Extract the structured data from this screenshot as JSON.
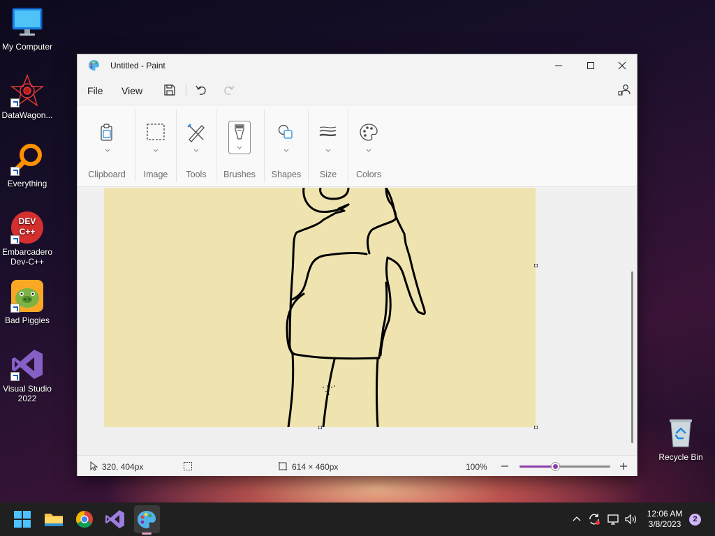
{
  "desktop": {
    "icons": [
      {
        "name": "my-computer",
        "label": "My Computer"
      },
      {
        "name": "datawagon",
        "label": "DataWagon..."
      },
      {
        "name": "everything",
        "label": "Everything"
      },
      {
        "name": "devcpp",
        "label": "Embarcadero Dev-C++",
        "logo": "DEV C++"
      },
      {
        "name": "bad-piggies",
        "label": "Bad Piggies"
      },
      {
        "name": "visual-studio",
        "label": "Visual Studio 2022"
      },
      {
        "name": "recycle-bin",
        "label": "Recycle Bin"
      }
    ]
  },
  "window": {
    "title": "Untitled - Paint",
    "menu": {
      "file": "File",
      "view": "View"
    },
    "ribbon": {
      "groups": [
        {
          "key": "clipboard",
          "label": "Clipboard",
          "icon": "clipboard-icon"
        },
        {
          "key": "image",
          "label": "Image",
          "icon": "selection-icon"
        },
        {
          "key": "tools",
          "label": "Tools",
          "icon": "tools-icon"
        },
        {
          "key": "brushes",
          "label": "Brushes",
          "icon": "brush-icon"
        },
        {
          "key": "shapes",
          "label": "Shapes",
          "icon": "shapes-icon"
        },
        {
          "key": "size",
          "label": "Size",
          "icon": "size-icon"
        },
        {
          "key": "colors",
          "label": "Colors",
          "icon": "palette-icon"
        }
      ]
    },
    "canvas": {
      "background": "#efe4b0",
      "stroke": "#000000"
    },
    "status": {
      "cursor_position": "320, 404px",
      "canvas_size": "614 × 460px",
      "zoom": "100%",
      "zoom_level": 0.4
    }
  },
  "taskbar": {
    "apps": [
      "start-icon",
      "file-explorer-icon",
      "chrome-icon",
      "visual-studio-icon",
      "paint-icon"
    ],
    "active_app": "paint",
    "clock": {
      "time": "12:06 AM",
      "date": "3/8/2023"
    },
    "notification_count": "2"
  },
  "colors": {
    "accent": "#8e3da9"
  }
}
